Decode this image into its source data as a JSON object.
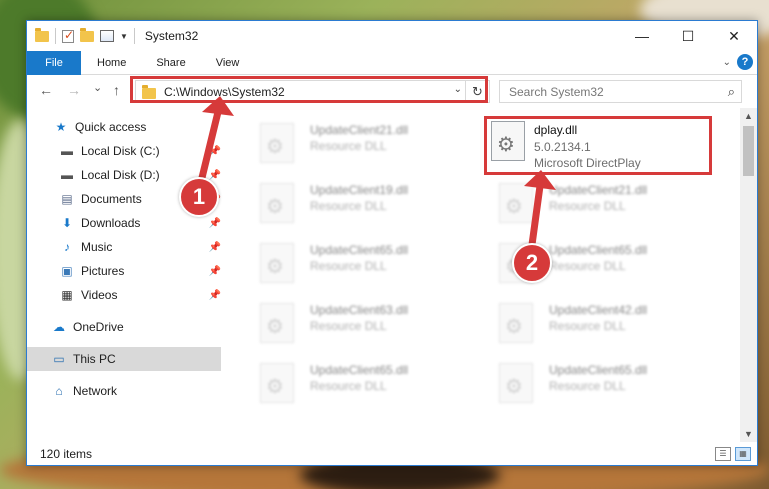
{
  "window": {
    "title": "System32",
    "controls": {
      "minimize": "—",
      "maximize": "☐",
      "close": "✕"
    }
  },
  "ribbon": {
    "tabs": [
      "File",
      "Home",
      "Share",
      "View"
    ],
    "help": "?"
  },
  "navigation": {
    "back": "←",
    "forward": "→",
    "recent": "⌄",
    "up": "↑",
    "address": "C:\\Windows\\System32",
    "search_placeholder": "Search System32"
  },
  "sidebar": {
    "items": [
      {
        "label": "Quick access",
        "icon": "star-icon",
        "pinned": false
      },
      {
        "label": "Local Disk (C:)",
        "icon": "drive-icon",
        "pinned": true
      },
      {
        "label": "Local Disk (D:)",
        "icon": "drive-icon",
        "pinned": true
      },
      {
        "label": "Documents",
        "icon": "documents-icon",
        "pinned": true
      },
      {
        "label": "Downloads",
        "icon": "download-icon",
        "pinned": true
      },
      {
        "label": "Music",
        "icon": "music-icon",
        "pinned": true
      },
      {
        "label": "Pictures",
        "icon": "pictures-icon",
        "pinned": true
      },
      {
        "label": "Videos",
        "icon": "videos-icon",
        "pinned": true
      },
      {
        "label": "OneDrive",
        "icon": "cloud-icon",
        "pinned": false
      },
      {
        "label": "This PC",
        "icon": "computer-icon",
        "pinned": false,
        "selected": true
      },
      {
        "label": "Network",
        "icon": "network-icon",
        "pinned": false
      }
    ]
  },
  "files": [
    {
      "name": "UpdateClient21.dll",
      "type": "Resource DLL"
    },
    {
      "name": "UpdateClient19.dll",
      "type": "Resource DLL"
    },
    {
      "name": "UpdateClient65.dll",
      "type": "Resource DLL"
    },
    {
      "name": "UpdateClient63.dll",
      "type": "Resource DLL"
    },
    {
      "name": "UpdateClient65.dll",
      "type": "Resource DLL"
    },
    {
      "name": "UpdateClient21.dll",
      "type": "Resource DLL"
    },
    {
      "name": "UpdateClient65.dll",
      "type": "Resource DLL"
    },
    {
      "name": "UpdateClient42.dll",
      "type": "Resource DLL"
    },
    {
      "name": "UpdateClient65.dll",
      "type": "Resource DLL"
    }
  ],
  "highlighted_file": {
    "name": "dplay.dll",
    "version": "5.0.2134.1",
    "description": "Microsoft DirectPlay"
  },
  "status": {
    "item_count": "120 items"
  },
  "annotations": {
    "step1": "1",
    "step2": "2",
    "color": "#d63a3a"
  },
  "colors": {
    "accent": "#1979ca",
    "highlight": "#d63a3a",
    "selected_bg": "#d9d9d9"
  }
}
